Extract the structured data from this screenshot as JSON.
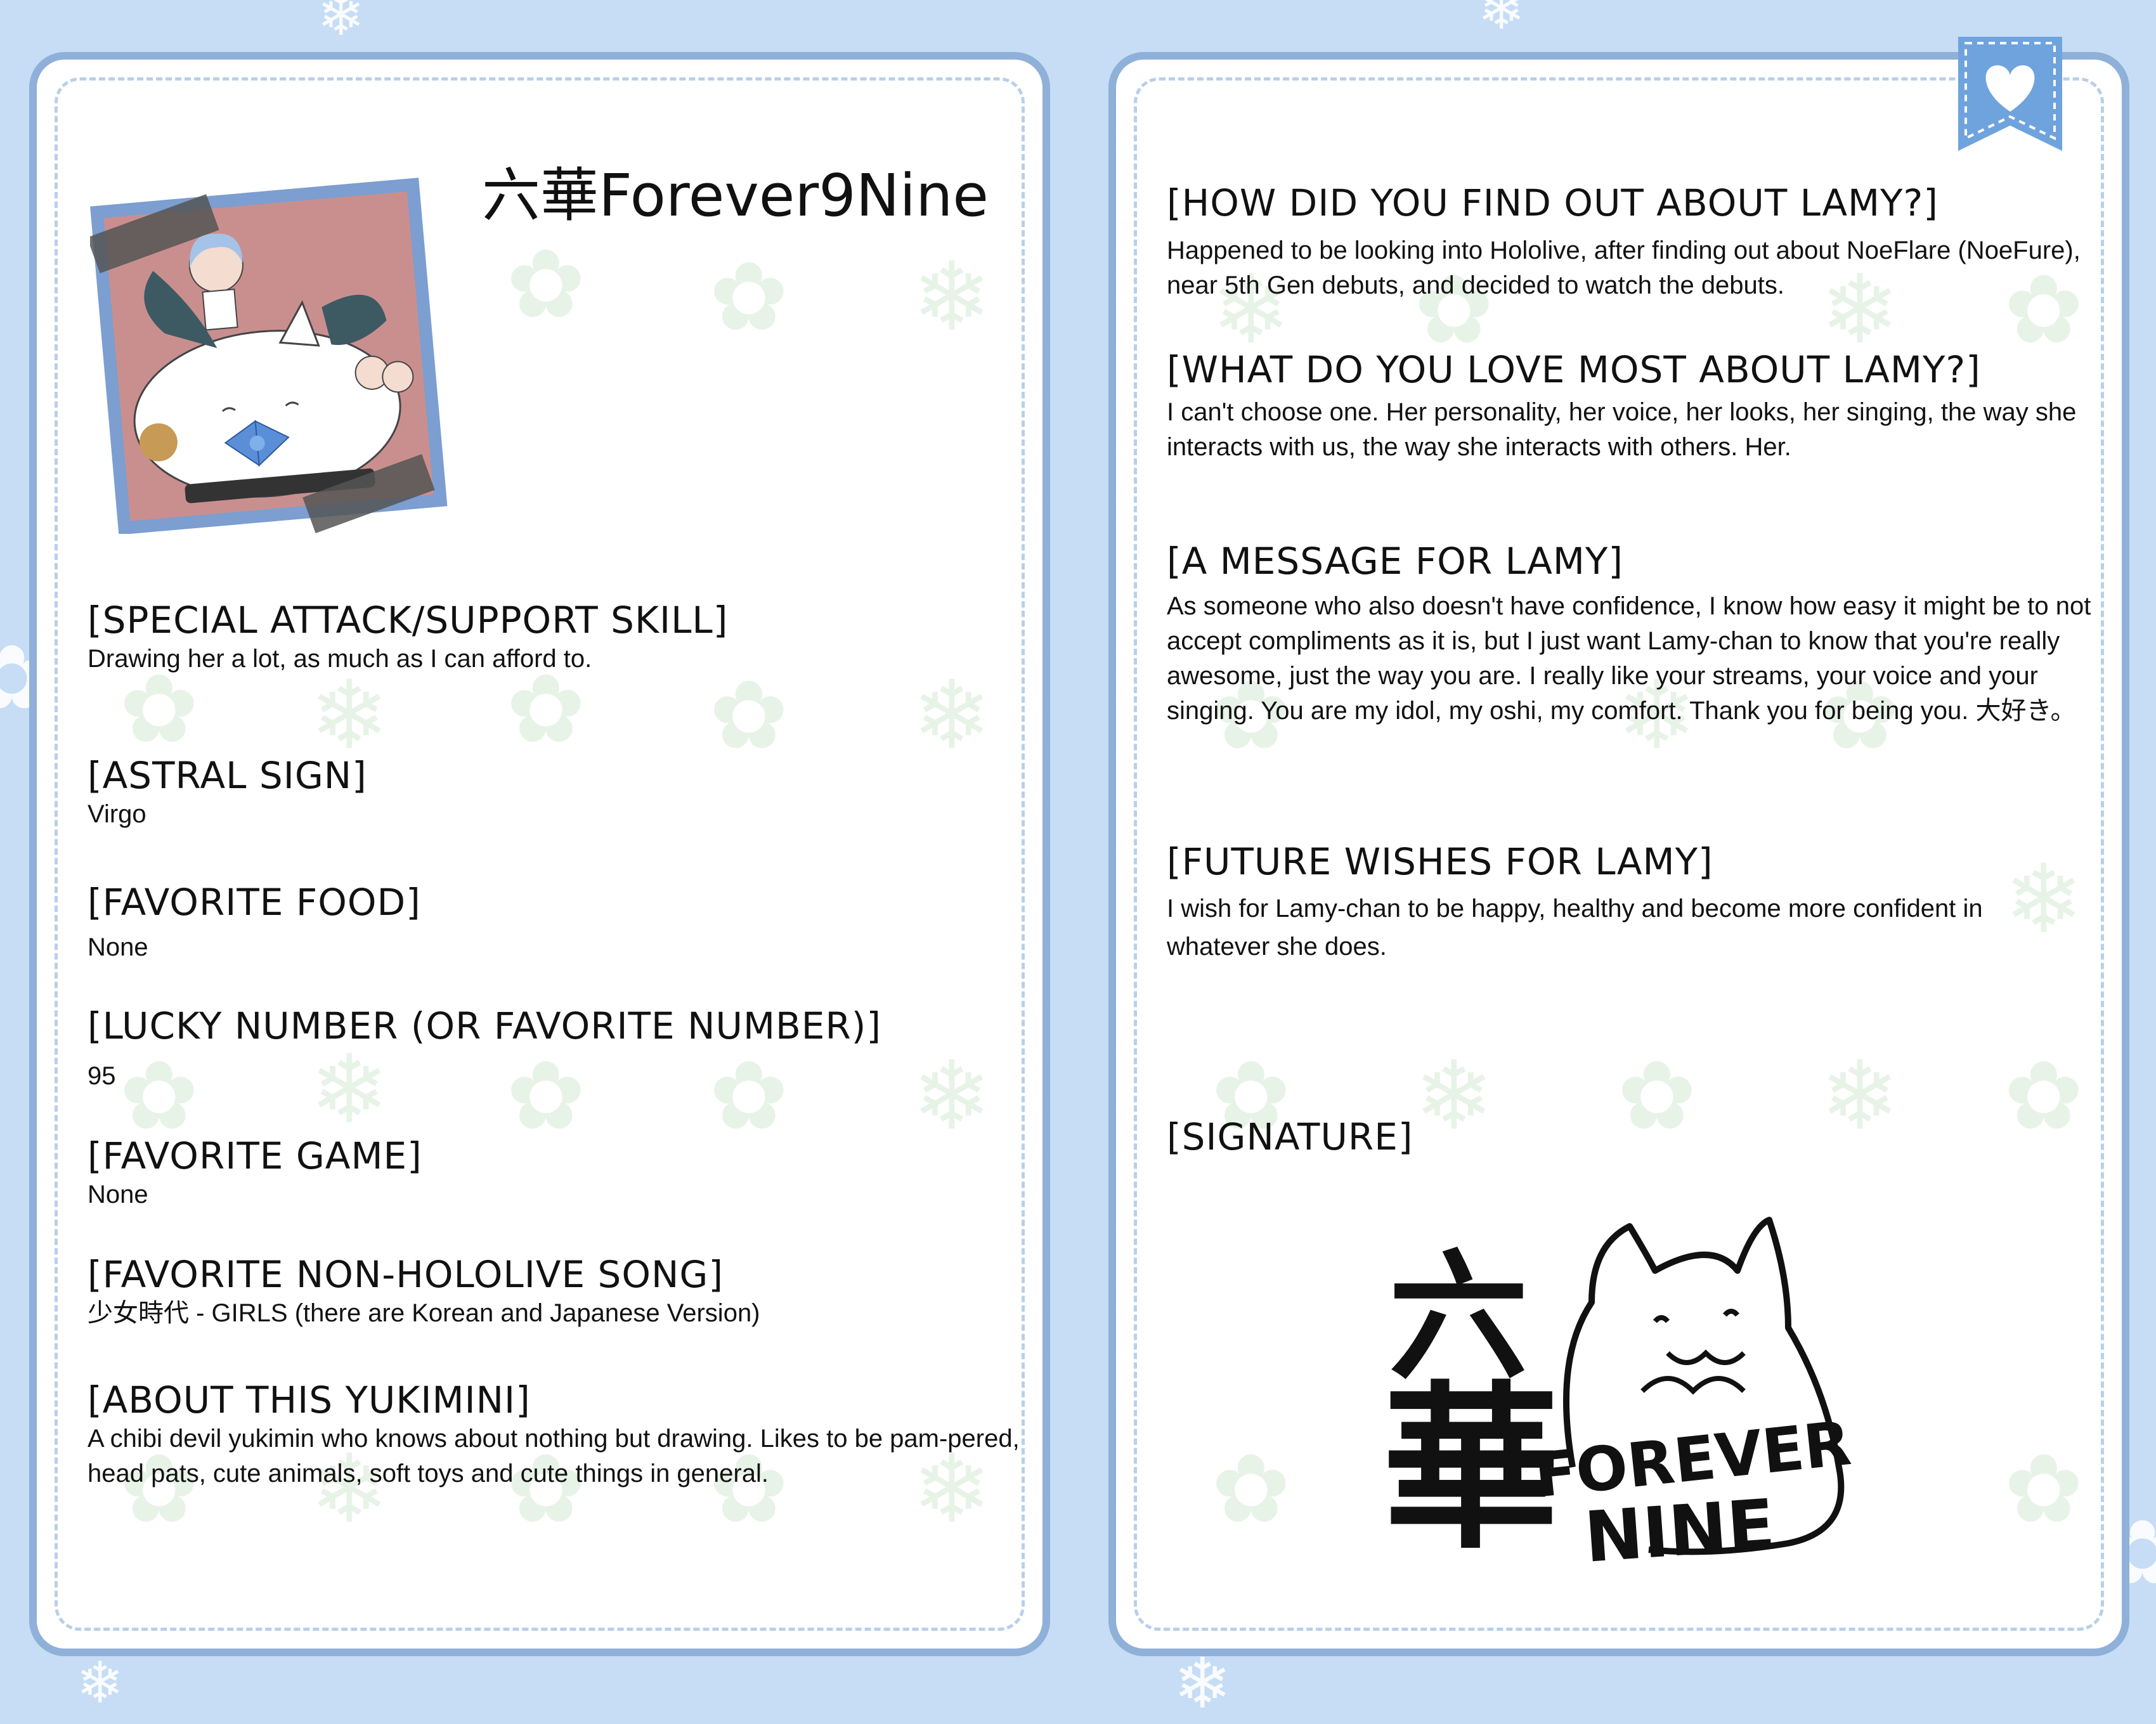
{
  "header": {
    "name": "六華Forever9Nine"
  },
  "left_sections": [
    {
      "heading": "[SPECIAL ATTACK/SUPPORT SKILL]",
      "text": "Drawing her a lot, as much as I can afford to."
    },
    {
      "heading": "[ASTRAL SIGN]",
      "text": "Virgo"
    },
    {
      "heading": "[FAVORITE FOOD]",
      "text": "None"
    },
    {
      "heading": "[LUCKY NUMBER (OR FAVORITE NUMBER)]",
      "text": "95"
    },
    {
      "heading": "[FAVORITE GAME]",
      "text": "None"
    },
    {
      "heading": "[FAVORITE NON-HOLOLIVE SONG]",
      "text": "少女時代 - GIRLS (there are Korean and Japanese Version)"
    },
    {
      "heading": "[ABOUT THIS YUKIMINI]",
      "text": "A chibi devil yukimin who knows about nothing but drawing. Likes to be pam-pered, head pats, cute animals, soft toys and cute things in general."
    }
  ],
  "right_sections": [
    {
      "heading": "[HOW DID YOU FIND OUT ABOUT LAMY?]",
      "text": "Happened to be looking into Hololive, after finding out about NoeFlare (NoeFure), near 5th Gen debuts, and decided to watch the debuts."
    },
    {
      "heading": "[WHAT DO YOU LOVE MOST ABOUT LAMY?]",
      "text": "I can't choose one. Her personality, her voice, her looks, her singing, the way she interacts with us, the way she interacts with others. Her."
    },
    {
      "heading": "[A MESSAGE FOR LAMY]",
      "text": "As someone who also doesn't have confidence, I know how easy it might be to not accept compliments as it is, but I just want Lamy-chan to know that you're really awesome, just the way you are. I really like your streams, your voice and your singing. You are my idol, my oshi, my comfort. Thank you for being you. 大好き。"
    },
    {
      "heading": "[FUTURE WISHES FOR LAMY]",
      "text": "I wish for Lamy-chan to be happy, healthy and become more confident in whatever she does."
    },
    {
      "heading": "[SIGNATURE]",
      "text": ""
    }
  ],
  "signature": {
    "kanji_top": "六",
    "kanji_main": "華",
    "line1": "FOREVER",
    "line2": "NINE"
  },
  "icons": {
    "ribbon": "heart-bookmark-icon",
    "photo": "chibi-artwork"
  },
  "colors": {
    "background": "#c6ddf5",
    "panel_border": "#8fb0d8",
    "dash": "#b9cfe9",
    "ribbon": "#6fa3dd"
  }
}
